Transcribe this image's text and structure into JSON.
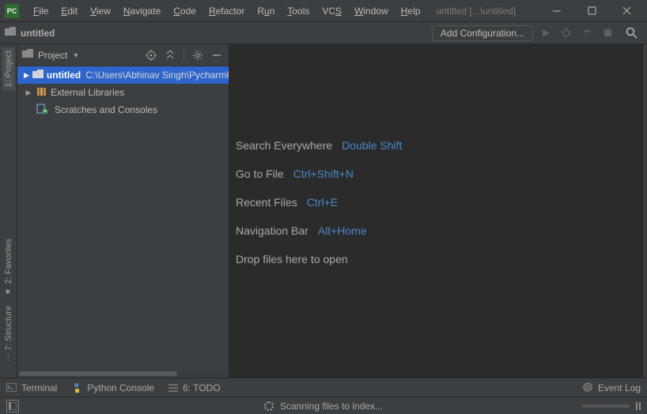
{
  "app": {
    "icon_label": "PC"
  },
  "menu": {
    "file": "File",
    "edit": "Edit",
    "view": "View",
    "navigate": "Navigate",
    "code": "Code",
    "refactor": "Refactor",
    "run": "Run",
    "tools": "Tools",
    "vcs": "VCS",
    "window": "Window",
    "help": "Help"
  },
  "title": "untitled [...\\untitled]",
  "breadcrumb": {
    "project": "untitled"
  },
  "toolbar": {
    "config_btn": "Add Configuration..."
  },
  "side": {
    "header": "Project",
    "tree": {
      "root_name": "untitled",
      "root_path": "C:\\Users\\Abhinav Singh\\PycharmProjects\\untitled",
      "ext_libs": "External Libraries",
      "scratches": "Scratches and Consoles"
    }
  },
  "gutter": {
    "project": "1: Project",
    "favorites": "2: Favorites",
    "structure": "7: Structure"
  },
  "hints": [
    {
      "label": "Search Everywhere",
      "key": "Double Shift"
    },
    {
      "label": "Go to File",
      "key": "Ctrl+Shift+N"
    },
    {
      "label": "Recent Files",
      "key": "Ctrl+E"
    },
    {
      "label": "Navigation Bar",
      "key": "Alt+Home"
    },
    {
      "label": "Drop files here to open",
      "key": ""
    }
  ],
  "bottom": {
    "terminal": "Terminal",
    "python_console": "Python Console",
    "todo": "6: TODO",
    "event_log": "Event Log"
  },
  "status": {
    "text": "Scanning files to index..."
  }
}
